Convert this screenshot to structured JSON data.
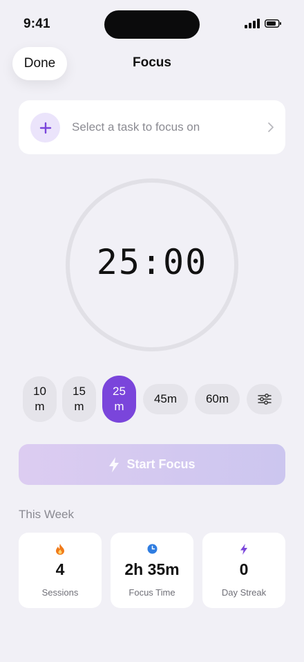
{
  "status_bar": {
    "time": "9:41"
  },
  "header": {
    "done_label": "Done",
    "title": "Focus"
  },
  "task": {
    "placeholder": "Select a task to focus on"
  },
  "timer": {
    "display": "25:00"
  },
  "durations": {
    "selected": "25 m",
    "options": [
      {
        "label": "10 m"
      },
      {
        "label": "15 m"
      },
      {
        "label": "25 m"
      },
      {
        "label": "45m"
      },
      {
        "label": "60m"
      }
    ]
  },
  "start_button": {
    "label": "Start Focus",
    "icon": "bolt-icon"
  },
  "week": {
    "heading": "This Week",
    "stats": [
      {
        "value": "4",
        "label": "Sessions",
        "icon": "flame-icon",
        "color": "#f07a1a"
      },
      {
        "value": "2h 35m",
        "label": "Focus Time",
        "icon": "clock-icon",
        "color": "#2f7de1"
      },
      {
        "value": "0",
        "label": "Day Streak",
        "icon": "bolt-icon",
        "color": "#7a45db"
      }
    ]
  },
  "colors": {
    "accent": "#7a45db",
    "accent_light": "#ebe4fb",
    "background": "#f1f0f6",
    "start_button_gradient": [
      "#dcccf1",
      "#ccc6ef"
    ]
  }
}
